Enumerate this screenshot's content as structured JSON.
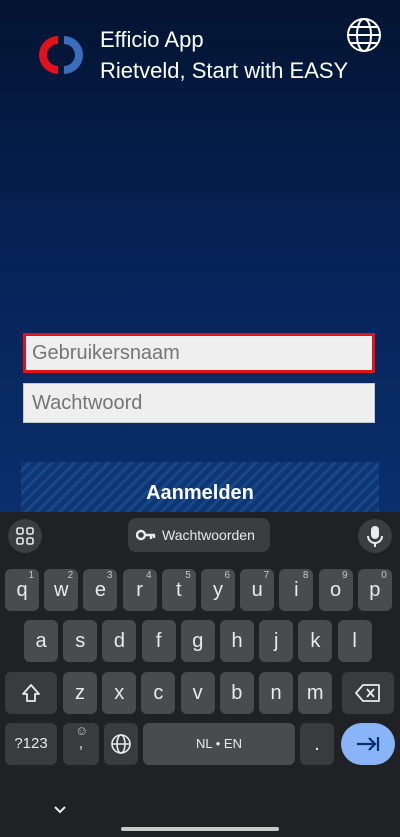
{
  "app": {
    "title_line1": "Efficio App",
    "title_line2": "Rietveld, Start with EASY",
    "icons": {
      "logo": "efficio-logo",
      "language": "globe-icon"
    },
    "colors": {
      "accent": "#e1121b",
      "logo_blue": "#3a6dba",
      "background": "#06245a"
    }
  },
  "form": {
    "username_placeholder": "Gebruikersnaam",
    "password_placeholder": "Wachtwoord",
    "login_label": "Aanmelden"
  },
  "keyboard": {
    "suggestion": "Wachtwoorden",
    "row1": [
      {
        "key": "q",
        "num": "1"
      },
      {
        "key": "w",
        "num": "2"
      },
      {
        "key": "e",
        "num": "3"
      },
      {
        "key": "r",
        "num": "4"
      },
      {
        "key": "t",
        "num": "5"
      },
      {
        "key": "y",
        "num": "6"
      },
      {
        "key": "u",
        "num": "7"
      },
      {
        "key": "i",
        "num": "8"
      },
      {
        "key": "o",
        "num": "9"
      },
      {
        "key": "p",
        "num": "0"
      }
    ],
    "row2": [
      "a",
      "s",
      "d",
      "f",
      "g",
      "h",
      "j",
      "k",
      "l"
    ],
    "row3": [
      "z",
      "x",
      "c",
      "v",
      "b",
      "n",
      "m"
    ],
    "symbols": "?123",
    "comma": ",",
    "space_label": "NL • EN",
    "period": "."
  }
}
